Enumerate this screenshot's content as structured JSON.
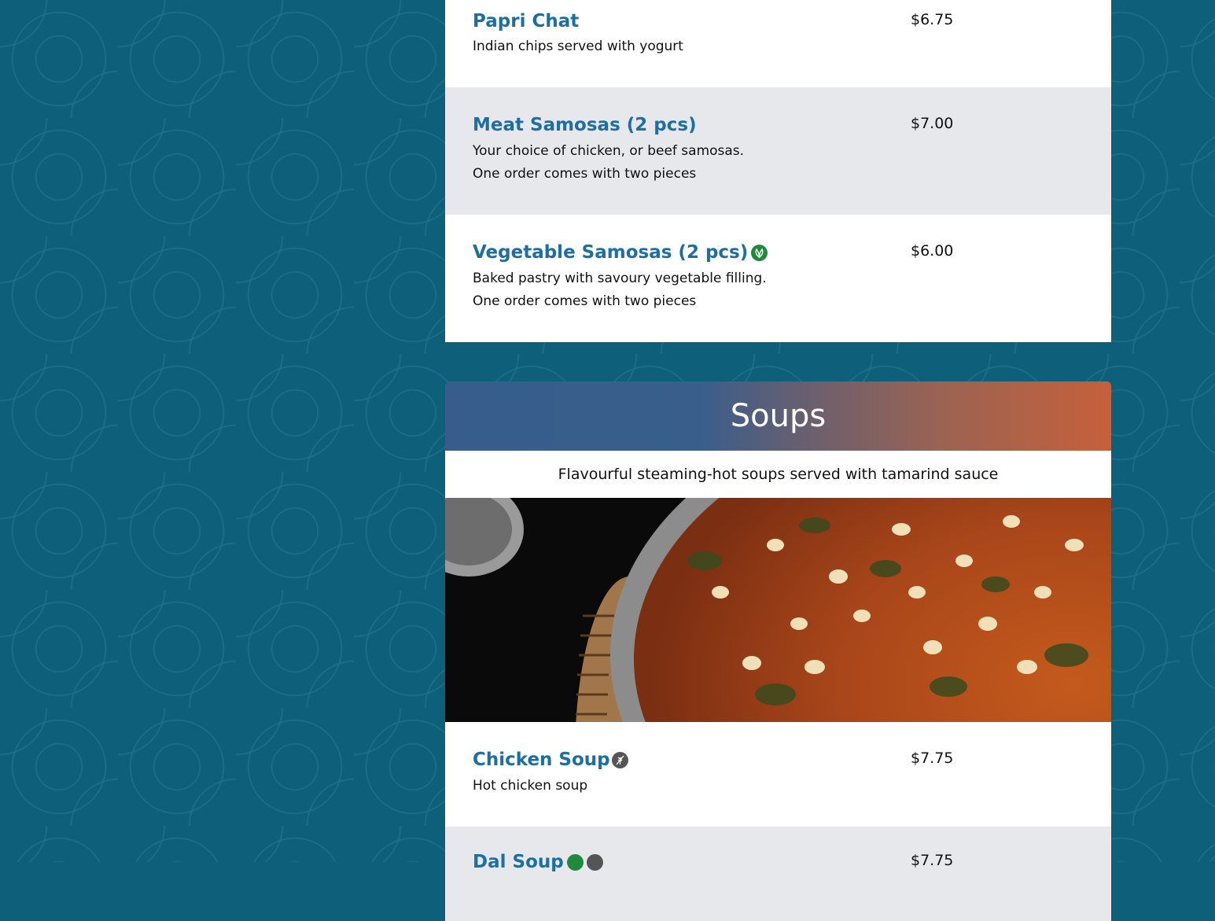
{
  "appetizers": {
    "items": [
      {
        "name": "Papri Chat",
        "desc": [
          "Indian chips served with yogurt"
        ],
        "price": "$6.75"
      },
      {
        "name": "Meat Samosas (2 pcs)",
        "desc": [
          "Your choice of chicken, or beef samosas.",
          "One order comes with two pieces"
        ],
        "price": "$7.00"
      },
      {
        "name": "Vegetable Samosas (2 pcs)",
        "desc": [
          "Baked pastry with savoury vegetable filling.",
          "One order comes with two pieces"
        ],
        "price": "$6.00",
        "badges": [
          "vegetarian-icon"
        ]
      }
    ]
  },
  "soups": {
    "title": "Soups",
    "subtitle": "Flavourful steaming-hot soups served with tamarind sauce",
    "image_alt_icon": "soup-photo",
    "items": [
      {
        "name": "Chicken Soup",
        "desc": [
          "Hot chicken soup"
        ],
        "price": "$7.75",
        "badges": [
          "gluten-free-icon"
        ]
      },
      {
        "name": "Dal Soup",
        "desc": [],
        "price": "$7.75",
        "badges": [
          "vegetarian-icon",
          "gluten-free-icon"
        ]
      }
    ]
  },
  "colors": {
    "page_background": "#0d5f7a",
    "item_name": "#1d6fa3",
    "row_alt": "#e7e8eb",
    "header_gradient_start": "#365d8c",
    "header_gradient_end": "#c6603b",
    "veg_badge": "#1e8a3a",
    "gf_badge": "#555555"
  }
}
